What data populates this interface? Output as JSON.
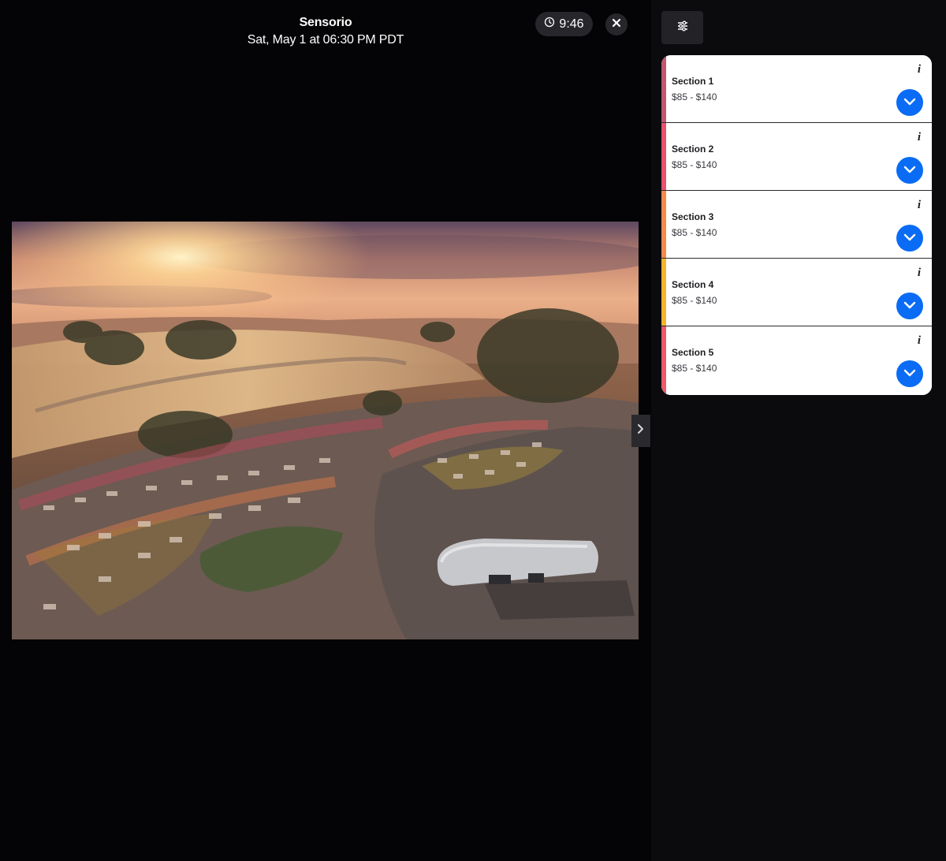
{
  "event": {
    "title": "Sensorio",
    "date": "Sat, May 1 at 06:30 PM PDT"
  },
  "timer": {
    "icon": "clock-icon",
    "value": "9:46"
  },
  "controls": {
    "close_icon": "close-icon",
    "next_icon": "chevron-right-icon",
    "filter_icon": "sliders-icon"
  },
  "sections": [
    {
      "name": "Section 1",
      "price": "$85 - $140",
      "color": "#c2566e"
    },
    {
      "name": "Section 2",
      "price": "$85 - $140",
      "color": "#e8516f"
    },
    {
      "name": "Section 3",
      "price": "$85 - $140",
      "color": "#f48a4a"
    },
    {
      "name": "Section 4",
      "price": "$85 - $140",
      "color": "#f5b52a"
    },
    {
      "name": "Section 5",
      "price": "$85 - $140",
      "color": "#ec5a6a"
    }
  ],
  "colors": {
    "accent": "#0a6cf5",
    "background": "#040406",
    "sidebar": "#0b0b0e"
  }
}
